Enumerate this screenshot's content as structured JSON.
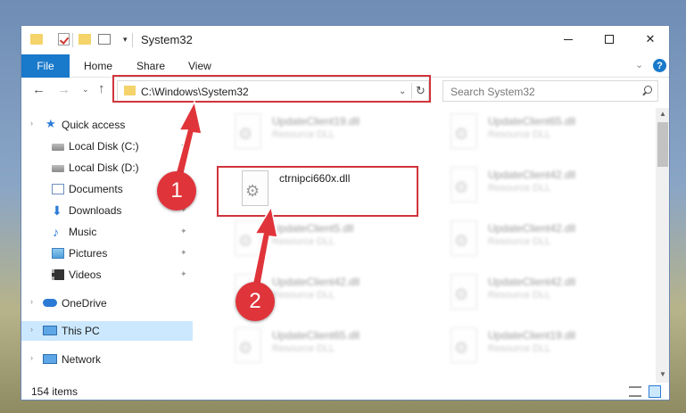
{
  "window": {
    "title": "System32",
    "min_glyph": "",
    "close_glyph": "✕"
  },
  "ribbon": {
    "tabs": [
      {
        "label": "File"
      },
      {
        "label": "Home"
      },
      {
        "label": "Share"
      },
      {
        "label": "View"
      }
    ],
    "help_glyph": "?",
    "collapse_glyph": "⌄"
  },
  "nav": {
    "back_glyph": "←",
    "forward_glyph": "→",
    "recent_glyph": "⌄",
    "up_glyph": "↑",
    "address": "C:\\Windows\\System32",
    "address_dropdown_glyph": "⌄",
    "refresh_glyph": "↻",
    "search_placeholder": "Search System32"
  },
  "sidebar": {
    "items": [
      {
        "label": "Quick access",
        "icon": "star-icon"
      },
      {
        "label": "Local Disk (C:)",
        "icon": "disk-icon"
      },
      {
        "label": "Local Disk (D:)",
        "icon": "disk-icon"
      },
      {
        "label": "Documents",
        "icon": "documents-icon"
      },
      {
        "label": "Downloads",
        "icon": "download-icon"
      },
      {
        "label": "Music",
        "icon": "music-icon"
      },
      {
        "label": "Pictures",
        "icon": "pictures-icon"
      },
      {
        "label": "Videos",
        "icon": "videos-icon"
      },
      {
        "label": "OneDrive",
        "icon": "cloud-icon"
      },
      {
        "label": "This PC",
        "icon": "pc-icon"
      },
      {
        "label": "Network",
        "icon": "network-icon"
      }
    ],
    "pin_glyph": "✦"
  },
  "files": [
    {
      "name": "UpdateClient19.dll",
      "type": "Resource DLL"
    },
    {
      "name": "UpdateClient65.dll",
      "type": "Resource DLL"
    },
    {
      "name": "ctrnipci660x.dll",
      "type": ""
    },
    {
      "name": "UpdateClient42.dll",
      "type": "Resource DLL"
    },
    {
      "name": "UpdateClient5.dll",
      "type": "Resource DLL"
    },
    {
      "name": "UpdateClient42.dll",
      "type": "Resource DLL"
    },
    {
      "name": "UpdateClient42.dll",
      "type": "Resource DLL"
    },
    {
      "name": "UpdateClient42.dll",
      "type": "Resource DLL"
    },
    {
      "name": "UpdateClient65.dll",
      "type": "Resource DLL"
    },
    {
      "name": "UpdateClient19.dll",
      "type": "Resource DLL"
    }
  ],
  "status": {
    "item_count": "154 items"
  },
  "annotations": {
    "step1": "1",
    "step2": "2",
    "color": "#d0343b"
  },
  "colors": {
    "accent": "#1979ca",
    "selection": "#cce8ff"
  }
}
